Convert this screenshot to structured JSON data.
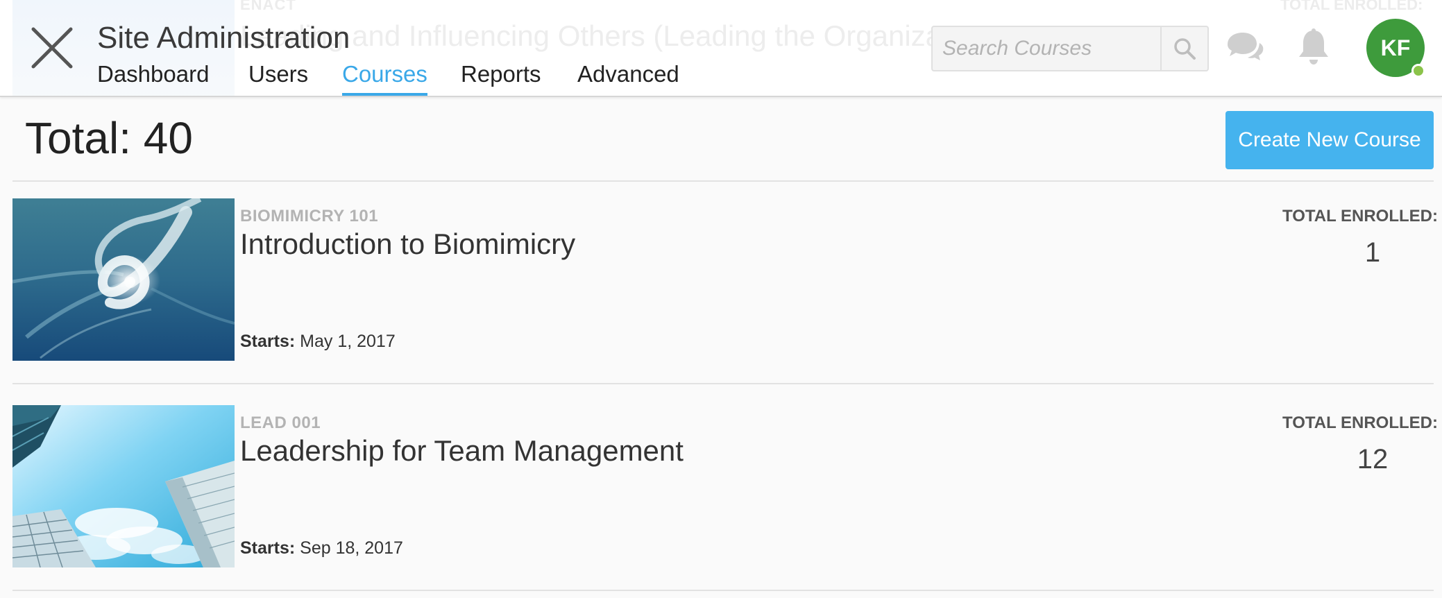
{
  "background_course": {
    "code": "ENACT",
    "title": "Leading and Influencing Others (Leading the Organization)",
    "enrolled_label": "TOTAL ENROLLED:"
  },
  "header": {
    "site_title": "Site Administration",
    "nav": [
      {
        "label": "Dashboard",
        "active": false
      },
      {
        "label": "Users",
        "active": false
      },
      {
        "label": "Courses",
        "active": true
      },
      {
        "label": "Reports",
        "active": false
      },
      {
        "label": "Advanced",
        "active": false
      }
    ],
    "search": {
      "placeholder": "Search Courses",
      "value": ""
    },
    "avatar_initials": "KF",
    "icons": {
      "close": "close-icon",
      "search": "search-icon",
      "chat": "chat-bubbles-icon",
      "notifications": "bell-icon"
    }
  },
  "main": {
    "total_text": "Total: 40",
    "create_button_label": "Create New Course",
    "courses": [
      {
        "code": "BIOMIMICRY 101",
        "title": "Introduction to Biomimicry",
        "starts_label": "Starts:",
        "starts_date": "May 1, 2017",
        "enrolled_label": "TOTAL ENROLLED:",
        "enrolled_count": "1",
        "image": "ocean-wave-swirl"
      },
      {
        "code": "LEAD 001",
        "title": "Leadership for Team Management",
        "starts_label": "Starts:",
        "starts_date": "Sep 18, 2017",
        "enrolled_label": "TOTAL ENROLLED:",
        "enrolled_count": "12",
        "image": "skyscrapers-sky"
      }
    ]
  },
  "colors": {
    "accent": "#45b3ee",
    "active_tab": "#3aa8e8",
    "avatar": "#3e9b3c",
    "online": "#8bc34a"
  }
}
